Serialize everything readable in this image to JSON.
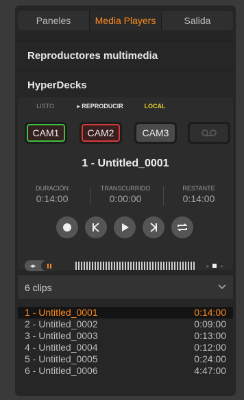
{
  "tabs": [
    {
      "label": "Paneles",
      "active": false
    },
    {
      "label": "Media Players",
      "active": true
    },
    {
      "label": "Salida",
      "active": false
    }
  ],
  "sections": {
    "media_players": "Reproductores multimedia",
    "hyperdecks": "HyperDecks"
  },
  "status": {
    "listo": "LISTO",
    "reproducir": "▸ REPRODUCIR",
    "local": "LOCAL"
  },
  "cams": [
    {
      "label": "CAM1",
      "state": "green"
    },
    {
      "label": "CAM2",
      "state": "red"
    },
    {
      "label": "CAM3",
      "state": "none"
    }
  ],
  "current_clip": "1 - Untitled_0001",
  "timecode": {
    "duracion_label": "DURACIÓN",
    "duracion_value": "0:14:00",
    "transcurrido_label": "TRANSCURRIDO",
    "transcurrido_value": "0:00:00",
    "restante_label": "RESTANTE",
    "restante_value": "0:14:00"
  },
  "clips_label": "6 clips",
  "clips": [
    {
      "name": "1 - Untitled_0001",
      "duration": "0:14:00",
      "selected": true
    },
    {
      "name": "2 - Untitled_0002",
      "duration": "0:09:00",
      "selected": false
    },
    {
      "name": "3 - Untitled_0003",
      "duration": "0:13:00",
      "selected": false
    },
    {
      "name": "4 - Untitled_0004",
      "duration": "0:12:00",
      "selected": false
    },
    {
      "name": "5 - Untitled_0005",
      "duration": "0:24:00",
      "selected": false
    },
    {
      "name": "6 - Untitled_0006",
      "duration": "4:47:00",
      "selected": false
    }
  ],
  "colors": {
    "accent": "#ff8a1f",
    "live_green": "#3fbf3f",
    "live_red": "#d83a3a",
    "local_yellow": "#e6d22a"
  }
}
